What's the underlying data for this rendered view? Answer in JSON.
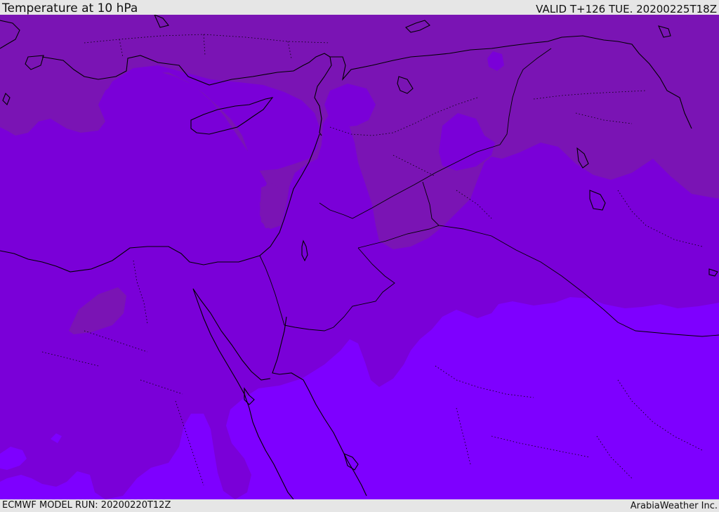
{
  "header": {
    "title": "Temperature at 10 hPa",
    "valid_time": "VALID T+126 TUE. 20200225T18Z"
  },
  "footer": {
    "model_run": "ECMWF MODEL RUN: 20200220T12Z",
    "credit": "ArabiaWeather Inc."
  },
  "map": {
    "region": "Eastern Mediterranean and Middle East",
    "colors": {
      "band_warm": "#7a14b4",
      "band_mid": "#7a00d8",
      "band_cool": "#7e00ff",
      "coast_line": "#000000",
      "border_line": "#000000"
    }
  }
}
